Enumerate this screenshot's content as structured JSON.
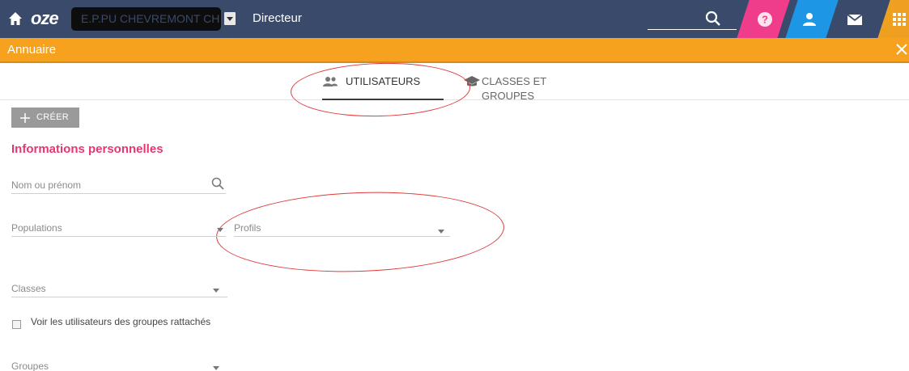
{
  "topbar": {
    "logo": "oze",
    "school_name": "E.P.PU CHEVREMONT CH",
    "role": "Directeur",
    "search_placeholder": "",
    "icons": [
      "home-icon",
      "search-icon",
      "help-icon",
      "user-icon",
      "mail-icon",
      "apps-grid-icon"
    ],
    "colors": {
      "bar": "#3a4a6b",
      "help": "#ef3d8b",
      "user": "#1e96e6",
      "apps": "#f0a020"
    }
  },
  "module": {
    "title": "Annuaire",
    "close_icon": "close-icon",
    "color": "#f6a21e"
  },
  "tabs": [
    {
      "label": "UTILISATEURS",
      "icon": "users-icon",
      "active": true
    },
    {
      "label": "CLASSES ET GROUPES",
      "icon": "graduation-cap-icon",
      "active": false
    }
  ],
  "actions": {
    "create_label": "CRÉER"
  },
  "section_title": "Informations personnelles",
  "accent_color": "#e5376f",
  "form": {
    "name_placeholder": "Nom ou prénom",
    "populations_label": "Populations",
    "profils_label": "Profils",
    "classes_label": "Classes",
    "attached_groups_label": "Voir les utilisateurs des groupes rattachés",
    "groups_label": "Groupes"
  }
}
